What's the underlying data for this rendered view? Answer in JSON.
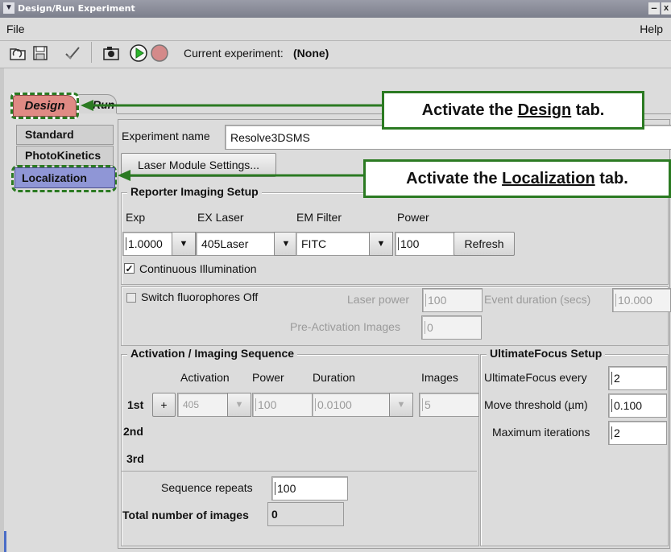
{
  "window": {
    "title": "Design/Run Experiment",
    "minimize": "–",
    "close": "x"
  },
  "menu": {
    "file": "File",
    "help": "Help"
  },
  "toolbar": {
    "current_label": "Current experiment:",
    "current_value": "(None)"
  },
  "tabs": {
    "design": "Design",
    "run": "Run"
  },
  "side_tabs": [
    "Standard",
    "PhotoKinetics",
    "Localization"
  ],
  "callouts": {
    "design": {
      "pre": "Activate the ",
      "key": "Design",
      "post": " tab."
    },
    "localization": {
      "pre": "Activate the ",
      "key": "Localization",
      "post": " tab."
    }
  },
  "experiment": {
    "name_label": "Experiment name",
    "name_value": "Resolve3DSMS",
    "laser_button": "Laser Module Settings..."
  },
  "reporter": {
    "title": "Reporter Imaging Setup",
    "col_exp": "Exp",
    "col_laser": "EX Laser",
    "col_filter": "EM Filter",
    "col_power": "Power",
    "exp": "1.0000",
    "laser": "405Laser",
    "filter": "FITC",
    "power": "100",
    "refresh": "Refresh",
    "continuous": "Continuous Illumination"
  },
  "switch": {
    "label": "Switch fluorophores Off",
    "laser_power_label": "Laser power",
    "laser_power": "100",
    "event_label": "Event duration (secs)",
    "event": "10.000",
    "preact_label": "Pre-Activation Images",
    "preact": "0"
  },
  "activation": {
    "title": "Activation / Imaging Sequence",
    "col_activation": "Activation",
    "col_power": "Power",
    "col_duration": "Duration",
    "col_images": "Images",
    "rows": [
      "1st",
      "2nd",
      "3rd"
    ],
    "add": "+",
    "act": "405",
    "power": "100",
    "duration": "0.0100",
    "images": "5",
    "repeats_label": "Sequence repeats",
    "repeats": "100",
    "total_label": "Total number of images",
    "total": "0"
  },
  "focus": {
    "title": "UltimateFocus Setup",
    "every_label": "UltimateFocus every",
    "every": "2",
    "threshold_label": "Move threshold (µm)",
    "threshold": "0.100",
    "max_label": "Maximum iterations",
    "max": "2"
  },
  "colors": {
    "callout_green": "#2b7a22",
    "design_tab": "#e08a84",
    "localization_tab": "#8f96d6"
  }
}
